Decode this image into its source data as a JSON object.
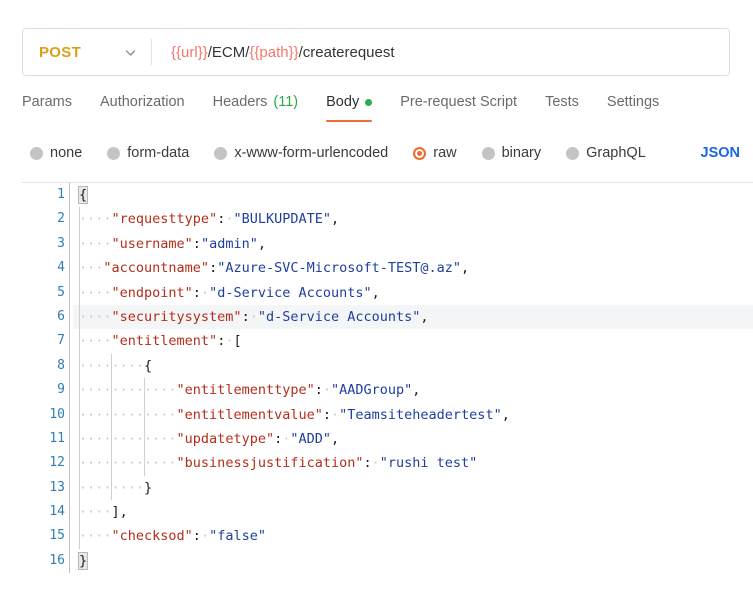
{
  "request": {
    "method": "POST",
    "method_chevron_icon": "chevron-down-icon",
    "url_parts": [
      {
        "text": "{{url}}",
        "kind": "var"
      },
      {
        "text": "/ECM/",
        "kind": "plain"
      },
      {
        "text": "{{path}}",
        "kind": "var"
      },
      {
        "text": "/createrequest",
        "kind": "plain"
      }
    ],
    "url_full": "{{url}}/ECM/{{path}}/createrequest"
  },
  "tabs": [
    {
      "label": "Params",
      "count": "",
      "active": false,
      "dot": false
    },
    {
      "label": "Authorization",
      "count": "",
      "active": false,
      "dot": false
    },
    {
      "label": "Headers",
      "count": "(11)",
      "active": false,
      "dot": false
    },
    {
      "label": "Body",
      "count": "",
      "active": true,
      "dot": true
    },
    {
      "label": "Pre-request Script",
      "count": "",
      "active": false,
      "dot": false
    },
    {
      "label": "Tests",
      "count": "",
      "active": false,
      "dot": false
    },
    {
      "label": "Settings",
      "count": "",
      "active": false,
      "dot": false
    }
  ],
  "body_types": [
    {
      "label": "none",
      "selected": false
    },
    {
      "label": "form-data",
      "selected": false
    },
    {
      "label": "x-www-form-urlencoded",
      "selected": false
    },
    {
      "label": "raw",
      "selected": true
    },
    {
      "label": "binary",
      "selected": false
    },
    {
      "label": "GraphQL",
      "selected": false
    }
  ],
  "raw_format": "JSON",
  "colors": {
    "accent_orange": "#ef6c35",
    "method_amber": "#d9a117",
    "tab_count_green": "#2aa84a",
    "body_dot_green": "#2aaf4a",
    "json_blue": "#1a68e0",
    "url_variable_red": "#f4776b",
    "code_key_red": "#b52e1c",
    "code_string_blue": "#1f3f9e",
    "gutter_blue": "#2f7fb5"
  },
  "editor": {
    "total_lines": 16,
    "active_line": 6,
    "raw_json": "{\n    \"requesttype\": \"BULKUPDATE\",\n    \"username\":\"admin\",\n   \"accountname\":\"Azure-SVC-Microsoft-TEST@.az\",\n    \"endpoint\": \"d-Service Accounts\",\n    \"securitysystem\": \"d-Service Accounts\",\n    \"entitlement\": [\n        {\n            \"entitlementtype\": \"AADGroup\",\n            \"entitlementvalue\": \"Teamsiteheadertest\",\n            \"updatetype\": \"ADD\",\n            \"businessjustification\": \"rushi test\"\n        }\n    ],\n    \"checksod\": \"false\"\n}",
    "lines": [
      {
        "n": 1,
        "indent": 0,
        "tokens": [
          {
            "t": "{",
            "c": "brace-hl"
          }
        ]
      },
      {
        "n": 2,
        "indent": 4,
        "tokens": [
          {
            "t": "\"requesttype\"",
            "c": "key"
          },
          {
            "t": ":",
            "c": "punct"
          },
          {
            "t": " ",
            "c": "ws"
          },
          {
            "t": "\"BULKUPDATE\"",
            "c": "str"
          },
          {
            "t": ",",
            "c": "punct"
          }
        ]
      },
      {
        "n": 3,
        "indent": 4,
        "tokens": [
          {
            "t": "\"username\"",
            "c": "key"
          },
          {
            "t": ":",
            "c": "punct"
          },
          {
            "t": "\"admin\"",
            "c": "str"
          },
          {
            "t": ",",
            "c": "punct"
          }
        ]
      },
      {
        "n": 4,
        "indent": 3,
        "tokens": [
          {
            "t": "\"accountname\"",
            "c": "key"
          },
          {
            "t": ":",
            "c": "punct"
          },
          {
            "t": "\"Azure-SVC-Microsoft-TEST@.az\"",
            "c": "str"
          },
          {
            "t": ",",
            "c": "punct"
          }
        ]
      },
      {
        "n": 5,
        "indent": 4,
        "tokens": [
          {
            "t": "\"endpoint\"",
            "c": "key"
          },
          {
            "t": ":",
            "c": "punct"
          },
          {
            "t": " ",
            "c": "ws"
          },
          {
            "t": "\"d-Service Accounts\"",
            "c": "str"
          },
          {
            "t": ",",
            "c": "punct"
          }
        ]
      },
      {
        "n": 6,
        "indent": 4,
        "tokens": [
          {
            "t": "\"securitysystem\"",
            "c": "key"
          },
          {
            "t": ":",
            "c": "punct"
          },
          {
            "t": " ",
            "c": "ws"
          },
          {
            "t": "\"d-Service Accounts\"",
            "c": "str"
          },
          {
            "t": ",",
            "c": "punct"
          }
        ]
      },
      {
        "n": 7,
        "indent": 4,
        "tokens": [
          {
            "t": "\"entitlement\"",
            "c": "key"
          },
          {
            "t": ":",
            "c": "punct"
          },
          {
            "t": " ",
            "c": "ws"
          },
          {
            "t": "[",
            "c": "punct"
          }
        ]
      },
      {
        "n": 8,
        "indent": 8,
        "tokens": [
          {
            "t": "{",
            "c": "punct"
          }
        ]
      },
      {
        "n": 9,
        "indent": 12,
        "tokens": [
          {
            "t": "\"entitlementtype\"",
            "c": "key"
          },
          {
            "t": ":",
            "c": "punct"
          },
          {
            "t": " ",
            "c": "ws"
          },
          {
            "t": "\"AADGroup\"",
            "c": "str"
          },
          {
            "t": ",",
            "c": "punct"
          }
        ]
      },
      {
        "n": 10,
        "indent": 12,
        "tokens": [
          {
            "t": "\"entitlementvalue\"",
            "c": "key"
          },
          {
            "t": ":",
            "c": "punct"
          },
          {
            "t": " ",
            "c": "ws"
          },
          {
            "t": "\"Teamsiteheadertest\"",
            "c": "str"
          },
          {
            "t": ",",
            "c": "punct"
          }
        ]
      },
      {
        "n": 11,
        "indent": 12,
        "tokens": [
          {
            "t": "\"updatetype\"",
            "c": "key"
          },
          {
            "t": ":",
            "c": "punct"
          },
          {
            "t": " ",
            "c": "ws"
          },
          {
            "t": "\"ADD\"",
            "c": "str"
          },
          {
            "t": ",",
            "c": "punct"
          }
        ]
      },
      {
        "n": 12,
        "indent": 12,
        "tokens": [
          {
            "t": "\"businessjustification\"",
            "c": "key"
          },
          {
            "t": ":",
            "c": "punct"
          },
          {
            "t": " ",
            "c": "ws"
          },
          {
            "t": "\"rushi test\"",
            "c": "str"
          }
        ]
      },
      {
        "n": 13,
        "indent": 8,
        "tokens": [
          {
            "t": "}",
            "c": "punct"
          }
        ]
      },
      {
        "n": 14,
        "indent": 4,
        "tokens": [
          {
            "t": "]",
            "c": "punct"
          },
          {
            "t": ",",
            "c": "punct"
          }
        ]
      },
      {
        "n": 15,
        "indent": 4,
        "tokens": [
          {
            "t": "\"checksod\"",
            "c": "key"
          },
          {
            "t": ":",
            "c": "punct"
          },
          {
            "t": " ",
            "c": "ws"
          },
          {
            "t": "\"false\"",
            "c": "str"
          }
        ]
      },
      {
        "n": 16,
        "indent": 0,
        "tokens": [
          {
            "t": "}",
            "c": "brace-hl"
          }
        ]
      }
    ],
    "indent_guides": [
      {
        "col": 0,
        "from_line": 2,
        "to_line": 15
      },
      {
        "col": 4,
        "from_line": 8,
        "to_line": 13
      },
      {
        "col": 8,
        "from_line": 9,
        "to_line": 12
      }
    ]
  }
}
